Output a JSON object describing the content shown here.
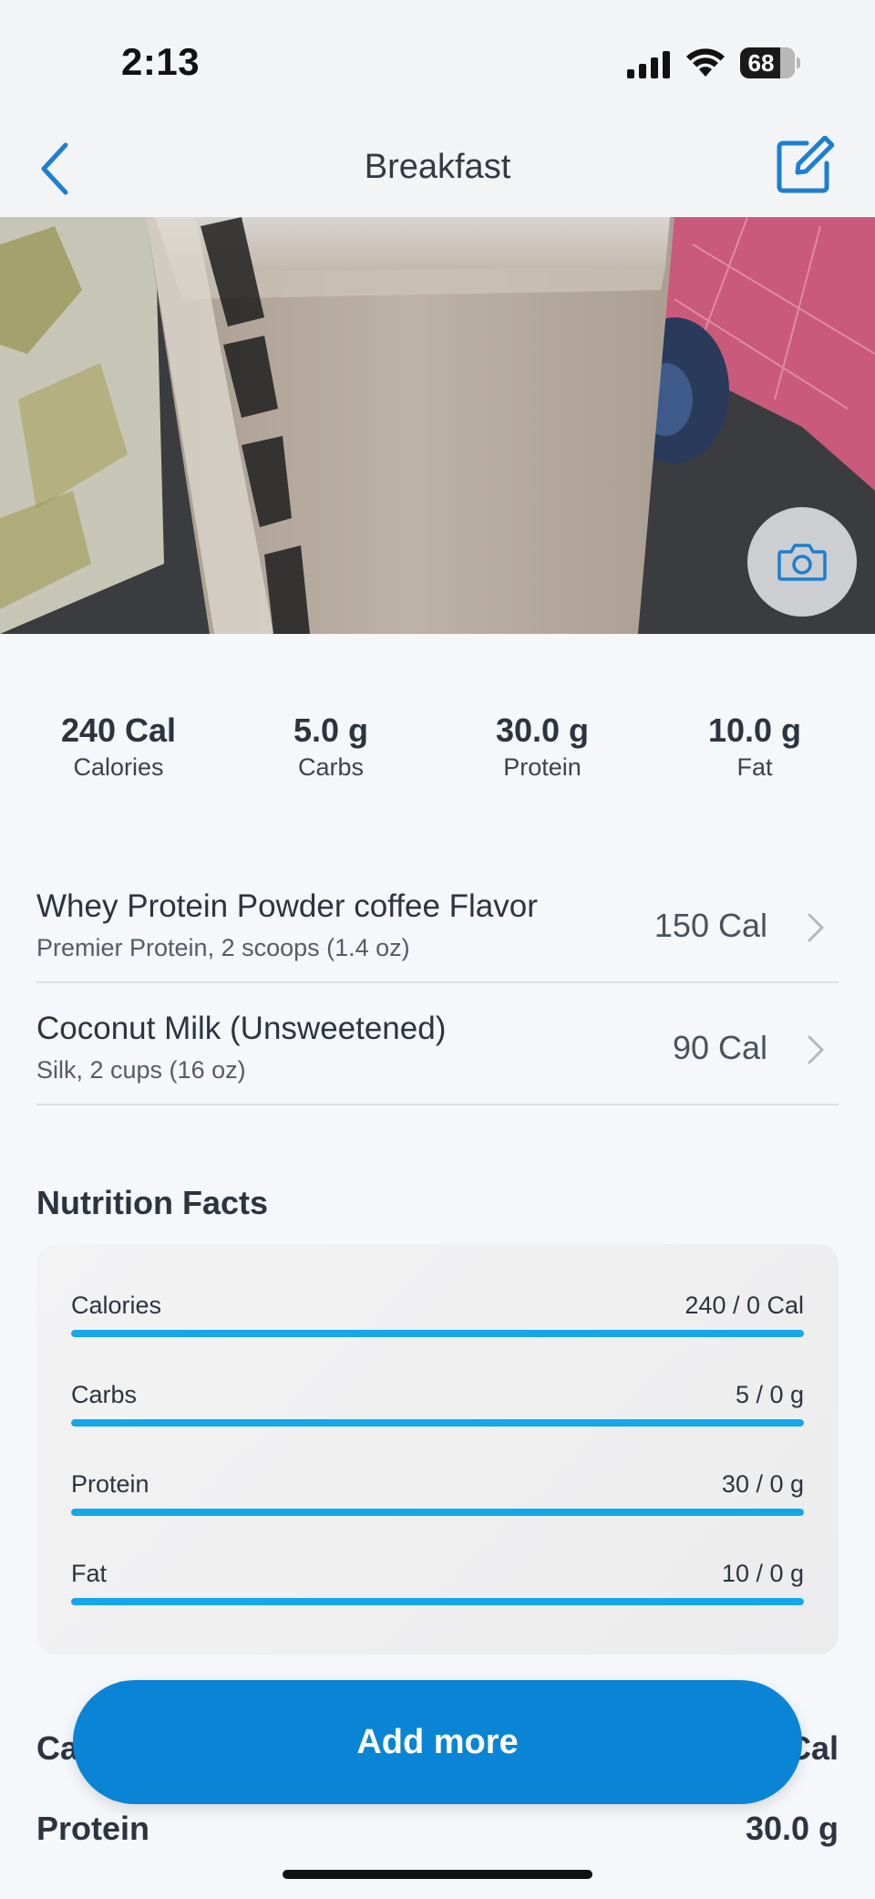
{
  "status_bar": {
    "time": "2:13",
    "battery": "68"
  },
  "nav": {
    "title": "Breakfast"
  },
  "summary": [
    {
      "value": "240 Cal",
      "label": "Calories"
    },
    {
      "value": "5.0 g",
      "label": "Carbs"
    },
    {
      "value": "30.0 g",
      "label": "Protein"
    },
    {
      "value": "10.0 g",
      "label": "Fat"
    }
  ],
  "foods": [
    {
      "name": "Whey Protein Powder coffee Flavor",
      "detail": "Premier Protein, 2 scoops (1.4 oz)",
      "calories": "150 Cal"
    },
    {
      "name": "Coconut Milk (Unsweetened)",
      "detail": "Silk, 2 cups (16 oz)",
      "calories": "90 Cal"
    }
  ],
  "nutrition_facts": {
    "title": "Nutrition Facts",
    "rows": [
      {
        "label": "Calories",
        "value": "240 / 0 Cal",
        "fill_fraction": 1.0
      },
      {
        "label": "Carbs",
        "value": "5 / 0 g",
        "fill_fraction": 1.0
      },
      {
        "label": "Protein",
        "value": "30 / 0 g",
        "fill_fraction": 1.0
      },
      {
        "label": "Fat",
        "value": "10 / 0 g",
        "fill_fraction": 1.0
      }
    ]
  },
  "totals": [
    {
      "label": "Calories",
      "value": "240 Cal"
    },
    {
      "label": "Protein",
      "value": "30.0 g"
    }
  ],
  "actions": {
    "add_more": "Add more"
  },
  "colors": {
    "accent": "#0a84d4",
    "progress": "#16a6ea"
  }
}
